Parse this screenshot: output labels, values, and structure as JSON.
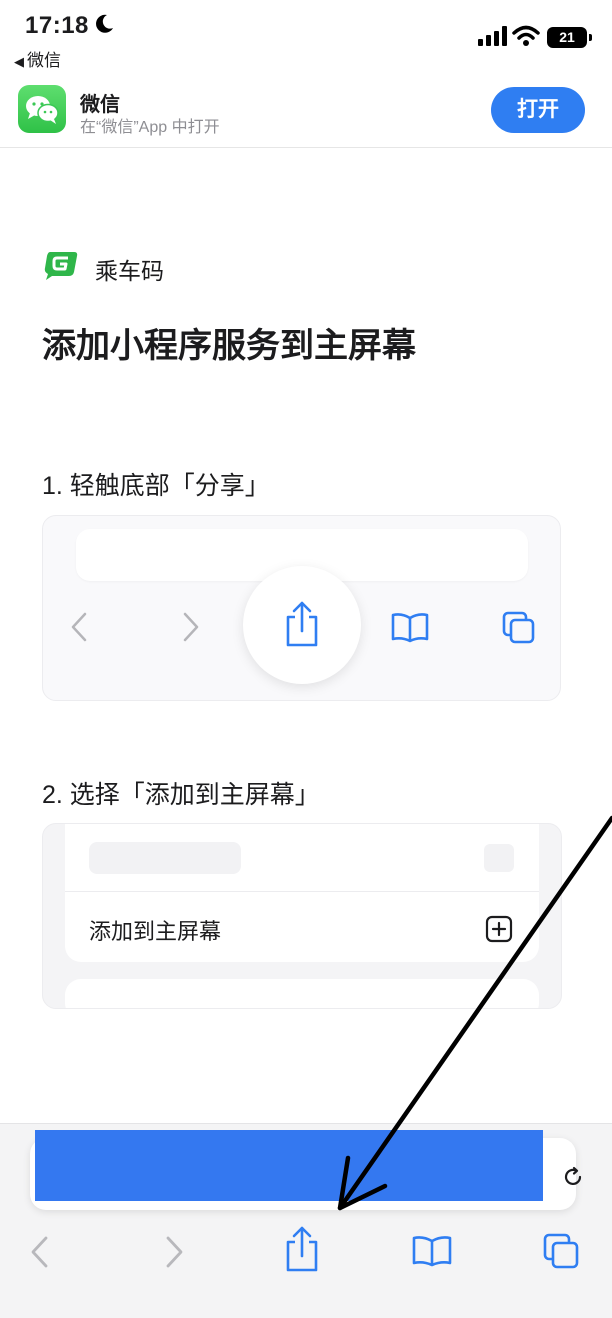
{
  "status_bar": {
    "time": "17:18",
    "back_app": "微信",
    "battery": "21"
  },
  "app_banner": {
    "name": "微信",
    "subtitle": "在“微信”App 中打开",
    "open_button": "打开"
  },
  "content": {
    "brand_name": "乘车码",
    "title": "添加小程序服务到主屏幕",
    "step1": "1. 轻触底部「分享」",
    "step2": "2. 选择「添加到主屏幕」",
    "step2_action": "添加到主屏幕"
  },
  "colors": {
    "accent": "#2f7ef2",
    "wechat_green": "#2fc147",
    "redaction_blue": "#3478f0"
  },
  "icons": {
    "toolbar": [
      "chevron-left-icon",
      "chevron-right-icon",
      "share-icon",
      "bookmarks-icon",
      "tabs-icon"
    ],
    "status": [
      "moon-icon",
      "signal-icon",
      "wifi-icon",
      "battery-icon"
    ]
  }
}
